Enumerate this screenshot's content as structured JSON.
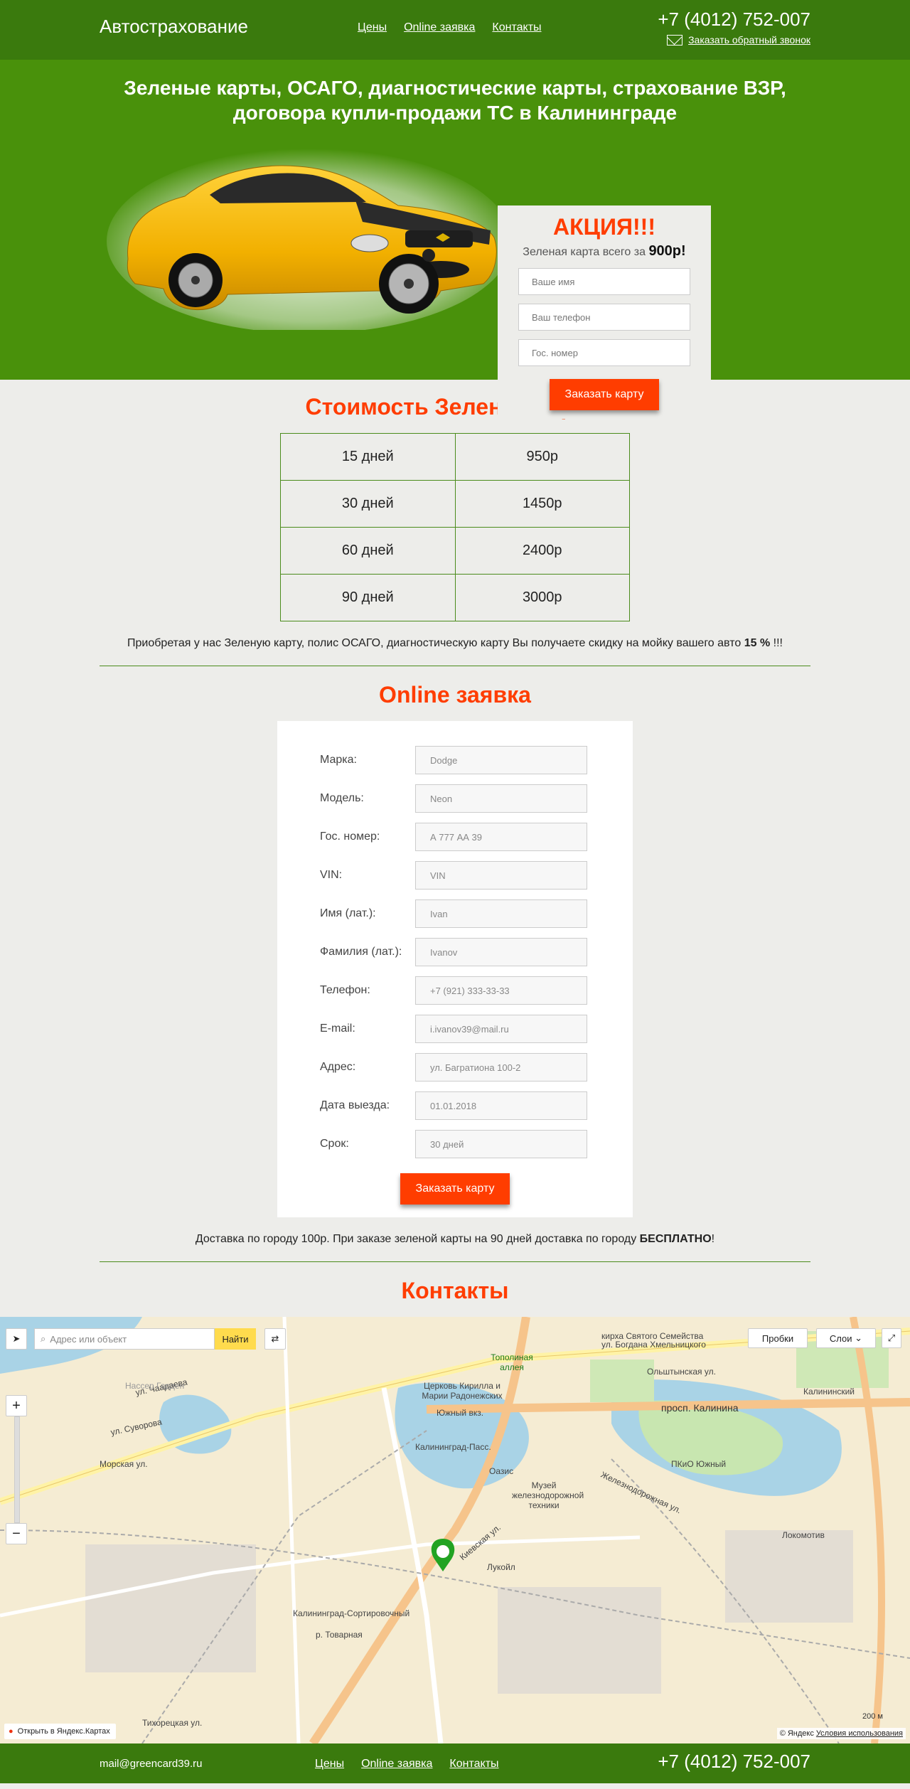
{
  "header": {
    "logo": "Автострахование",
    "nav": [
      "Цены",
      "Online заявка",
      "Контакты"
    ],
    "phone": "+7 (4012) 752-007",
    "callback": "Заказать обратный звонок"
  },
  "hero": {
    "title": "Зеленые карты, ОСАГО, диагностические карты, страхование ВЗР, договора купли-продажи ТС в Калининграде",
    "promo_title": "АКЦИЯ!!!",
    "promo_sub": "Зеленая карта всего за",
    "promo_price": "900р!",
    "name_placeholder": "Ваше имя",
    "phone_placeholder": "Ваш телефон",
    "plate_placeholder": "Гос. номер",
    "button": "Заказать карту"
  },
  "price": {
    "title": "Стоимость Зеленой карты",
    "rows": [
      {
        "period": "15 дней",
        "price": "950р"
      },
      {
        "period": "30 дней",
        "price": "1450р"
      },
      {
        "period": "60 дней",
        "price": "2400р"
      },
      {
        "period": "90 дней",
        "price": "3000р"
      }
    ],
    "note": "Приобретая у нас Зеленую карту, полис ОСАГО, диагностическую карту Вы получаете скидку на мойку вашего авто",
    "note_bold": "15 %",
    "note_end": "!!!"
  },
  "online": {
    "title": "Online заявка",
    "fields": [
      {
        "label": "Марка:",
        "placeholder": "Dodge"
      },
      {
        "label": "Модель:",
        "placeholder": "Neon"
      },
      {
        "label": "Гос. номер:",
        "placeholder": "А 777 АА 39"
      },
      {
        "label": "VIN:",
        "placeholder": "VIN"
      },
      {
        "label": "Имя (лат.):",
        "placeholder": "Ivan"
      },
      {
        "label": "Фамилия (лат.):",
        "placeholder": "Ivanov"
      },
      {
        "label": "Телефон:",
        "placeholder": "+7 (921) 333-33-33"
      },
      {
        "label": "E-mail:",
        "placeholder": "i.ivanov39@mail.ru"
      },
      {
        "label": "Адрес:",
        "placeholder": "ул. Багратиона 100-2"
      },
      {
        "label": "Дата выезда:",
        "placeholder": "01.01.2018"
      },
      {
        "label": "Срок:",
        "placeholder": "30 дней"
      }
    ],
    "button": "Заказать карту",
    "delivery": "Доставка по городу 100р. При заказе зеленой карты на 90 дней доставка по городу",
    "delivery_bold": "БЕСПЛАТНО",
    "delivery_end": "!"
  },
  "contacts": {
    "title": "Контакты",
    "map": {
      "search_placeholder": "Адрес или объект",
      "find": "Найти",
      "traffic": "Пробки",
      "layers": "Слои",
      "zoom_in": "+",
      "zoom_out": "−",
      "open_link": "Открыть в Яндекс.Картах",
      "copyright": "© Яндекс",
      "terms": "Условия использования",
      "scale": "200 м",
      "labels": {
        "kalinina": "просп. Калинина",
        "suvorova": "ул. Суворова",
        "chaadaeva": "ул. Чаадаева",
        "morskaya": "Морская ул.",
        "yuzhny_vokzal": "Южный вкз.",
        "kaliningrad_pass": "Калининград-Пасс.",
        "kaliningrad_sort": "Калининград-Сортировочный",
        "kievskaya": "Киевская ул.",
        "lukoil": "Лукойл",
        "oazis": "Оазис",
        "museum": "Музей железнодорожной техники",
        "park": "ПКиО Южный",
        "church": "Церковь Кирилла и Марии Радонежских",
        "olshtynskaya": "Ольштынская ул.",
        "kaliningradsky": "Калининский",
        "lokomotiv": "Локомотив",
        "topolinaya": "Тополиная аллея",
        "tihoretskaya": "Тихорецкая ул.",
        "tovarnaya": "р. Товарная",
        "kirha": "кирха Святого Семейства",
        "hmelnitskogo": "ул. Богдана Хмельницкого",
        "zheleznodor": "Железнодорожная ул.",
        "nasser": "Нассер Гарден"
      }
    }
  },
  "footer": {
    "email": "mail@greencard39.ru",
    "nav": [
      "Цены",
      "Online заявка",
      "Контакты"
    ],
    "phone": "+7 (4012) 752-007"
  },
  "colors": {
    "header_green": "#3a7a0d",
    "hero_green": "#49910b",
    "accent_orange": "#ff3d00",
    "background": "#ededea"
  }
}
